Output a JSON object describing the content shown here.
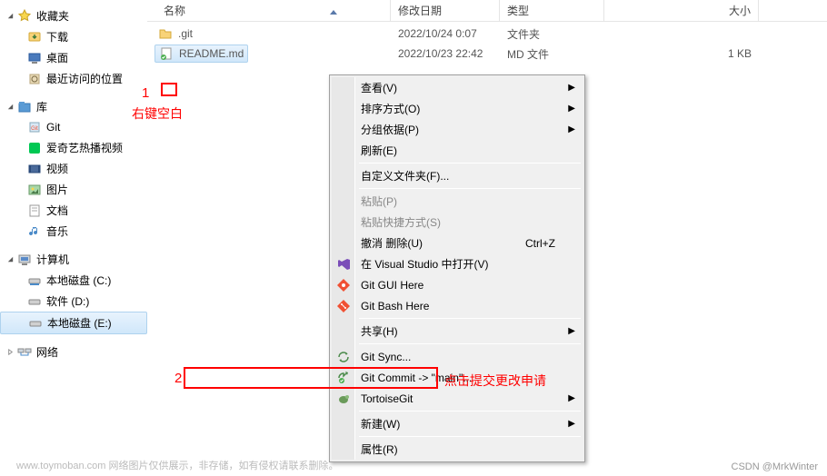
{
  "sidebar": {
    "favorites": {
      "label": "收藏夹",
      "items": [
        {
          "label": "下载",
          "icon": "download-icon"
        },
        {
          "label": "桌面",
          "icon": "desktop-icon"
        },
        {
          "label": "最近访问的位置",
          "icon": "recent-icon"
        }
      ]
    },
    "libraries": {
      "label": "库",
      "items": [
        {
          "label": "Git",
          "icon": "git-lib-icon"
        },
        {
          "label": "爱奇艺热播视频",
          "icon": "iqiyi-icon"
        },
        {
          "label": "视频",
          "icon": "video-icon"
        },
        {
          "label": "图片",
          "icon": "picture-icon"
        },
        {
          "label": "文档",
          "icon": "document-icon"
        },
        {
          "label": "音乐",
          "icon": "music-icon"
        }
      ]
    },
    "computer": {
      "label": "计算机",
      "items": [
        {
          "label": "本地磁盘 (C:)",
          "icon": "drive-icon"
        },
        {
          "label": "软件 (D:)",
          "icon": "drive-icon"
        },
        {
          "label": "本地磁盘 (E:)",
          "icon": "drive-icon",
          "selected": true
        }
      ]
    },
    "network": {
      "label": "网络"
    }
  },
  "list": {
    "headers": {
      "name": "名称",
      "date": "修改日期",
      "type": "类型",
      "size": "大小"
    },
    "rows": [
      {
        "name": ".git",
        "date": "2022/10/24 0:07",
        "type": "文件夹",
        "size": "",
        "icon": "folder-icon"
      },
      {
        "name": "README.md",
        "date": "2022/10/23 22:42",
        "type": "MD 文件",
        "size": "1 KB",
        "icon": "md-file-icon",
        "selected": true
      }
    ]
  },
  "menu": {
    "items": [
      {
        "label": "查看(V)",
        "submenu": true
      },
      {
        "label": "排序方式(O)",
        "submenu": true
      },
      {
        "label": "分组依据(P)",
        "submenu": true
      },
      {
        "label": "刷新(E)"
      },
      {
        "sep": true
      },
      {
        "label": "自定义文件夹(F)..."
      },
      {
        "sep": true
      },
      {
        "label": "粘贴(P)",
        "disabled": true
      },
      {
        "label": "粘贴快捷方式(S)",
        "disabled": true
      },
      {
        "label": "撤消 删除(U)",
        "shortcut": "Ctrl+Z"
      },
      {
        "label": "在 Visual Studio 中打开(V)",
        "icon": "vs-icon"
      },
      {
        "label": "Git GUI Here",
        "icon": "git-gui-icon"
      },
      {
        "label": "Git Bash Here",
        "icon": "git-bash-icon"
      },
      {
        "sep": true
      },
      {
        "label": "共享(H)",
        "submenu": true
      },
      {
        "sep": true
      },
      {
        "label": "Git Sync...",
        "icon": "git-sync-icon"
      },
      {
        "label": "Git Commit -> \"main\"...",
        "icon": "git-commit-icon"
      },
      {
        "label": "TortoiseGit",
        "icon": "tortoise-icon",
        "submenu": true
      },
      {
        "sep": true
      },
      {
        "label": "新建(W)",
        "submenu": true
      },
      {
        "sep": true
      },
      {
        "label": "属性(R)"
      }
    ]
  },
  "annotations": {
    "num1": "1",
    "text1": "右键空白",
    "num2": "2",
    "text2": "点击提交更改申请"
  },
  "watermark": "www.toymoban.com  网络图片仅供展示，非存储，如有侵权请联系删除。",
  "credit": "CSDN @MrkWinter"
}
